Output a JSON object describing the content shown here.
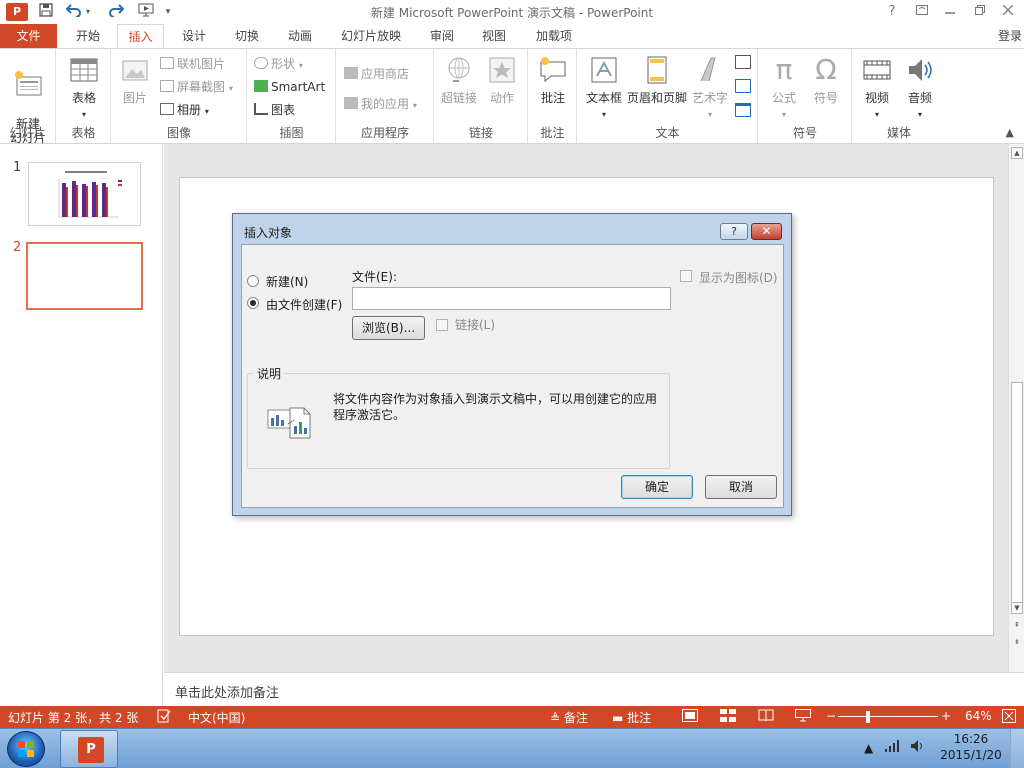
{
  "titlebar": {
    "app_logo": "P",
    "title": "新建 Microsoft PowerPoint 演示文稿 - PowerPoint",
    "help_glyph": "?",
    "qat_icons": [
      "save-icon",
      "undo-icon",
      "redo-icon",
      "start-from-beginning-icon",
      "customize-qat-icon"
    ]
  },
  "tabs": {
    "file": "文件",
    "items": [
      "开始",
      "插入",
      "设计",
      "切换",
      "动画",
      "幻灯片放映",
      "审阅",
      "视图",
      "加载项"
    ],
    "active": "插入",
    "login": "登录"
  },
  "ribbon": {
    "groups": {
      "slides": {
        "label": "幻灯片",
        "new_slide": "新建\n幻灯片"
      },
      "tables": {
        "label": "表格",
        "table": "表格"
      },
      "images": {
        "label": "图像",
        "picture": "图片",
        "online_pictures": "联机图片",
        "screenshot": "屏幕截图",
        "album": "相册"
      },
      "illustrations": {
        "label": "插图",
        "shapes": "形状",
        "smartart": "SmartArt",
        "chart": "图表"
      },
      "apps": {
        "label": "应用程序",
        "store": "应用商店",
        "my_apps": "我的应用"
      },
      "links": {
        "label": "链接",
        "hyperlink": "超链接",
        "action": "动作"
      },
      "comments": {
        "label": "批注",
        "comment": "批注"
      },
      "text": {
        "label": "文本",
        "textbox": "文本框",
        "header_footer": "页眉和页脚",
        "wordart": "艺术字"
      },
      "symbols": {
        "label": "符号",
        "equation": "公式",
        "symbol": "符号"
      },
      "media": {
        "label": "媒体",
        "video": "视频",
        "audio": "音频"
      }
    }
  },
  "thumbnails": [
    {
      "number": "1",
      "selected": false
    },
    {
      "number": "2",
      "selected": true
    }
  ],
  "notes": {
    "placeholder": "单击此处添加备注"
  },
  "statusbar": {
    "slide_info": "幻灯片 第 2 张，共 2 张",
    "language": "中文(中国)",
    "notes": "备注",
    "comments": "批注",
    "zoom": "64%",
    "zoom_level": 0.64
  },
  "dialog": {
    "title": "插入对象",
    "help": "?",
    "close": "✕",
    "radio_new": "新建(N)",
    "radio_from_file": "由文件创建(F)",
    "selected_option": "由文件创建(F)",
    "file_label": "文件(E):",
    "file_value": "",
    "browse": "浏览(B)...",
    "link": "链接(L)",
    "display_as_icon": "显示为图标(D)",
    "description_label": "说明",
    "description_text": "将文件内容作为对象插入到演示文稿中，可以用创建它的应用程序激活它。",
    "ok": "确定",
    "cancel": "取消"
  },
  "taskbar": {
    "time": "16:26",
    "date": "2015/1/20",
    "app": "P"
  },
  "colors": {
    "accent": "#d24726",
    "dialog_frame": "#bfd4ea",
    "selection_border": "#e1714a"
  }
}
